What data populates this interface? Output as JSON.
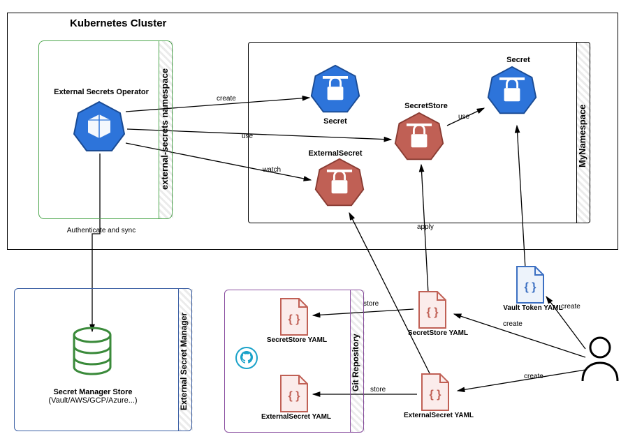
{
  "cluster": {
    "title": "Kubernetes Cluster",
    "eso_namespace_label": "external-secrets namespace",
    "my_namespace_label": "MyNamespace",
    "eso_title": "External Secrets Operator",
    "auth_sync_label": "Authenticate and sync",
    "secret1_label": "Secret",
    "secret2_label": "Secret",
    "secretstore_label": "SecretStore",
    "externalsecret_label": "ExternalSecret"
  },
  "edges": {
    "create": "create",
    "use1": "use",
    "use2": "use",
    "watch": "watch",
    "apply": "apply",
    "store1": "store",
    "store2": "store",
    "create_vt": "create",
    "create_ss": "create",
    "create_es": "create"
  },
  "esm": {
    "container_label": "External Secret Manager",
    "store_label_line1": "Secret Manager Store",
    "store_label_line2": "(Vault/AWS/GCP/Azure...)"
  },
  "git": {
    "container_label": "Git Repository",
    "ss_yaml_label": "SecretStore YAML",
    "es_yaml_label": "ExternalSecret YAML"
  },
  "user_files": {
    "ss_yaml_label": "SecretStore YAML",
    "es_yaml_label": "ExternalSecret YAML",
    "vt_yaml_label": "Vault Token YAML"
  }
}
